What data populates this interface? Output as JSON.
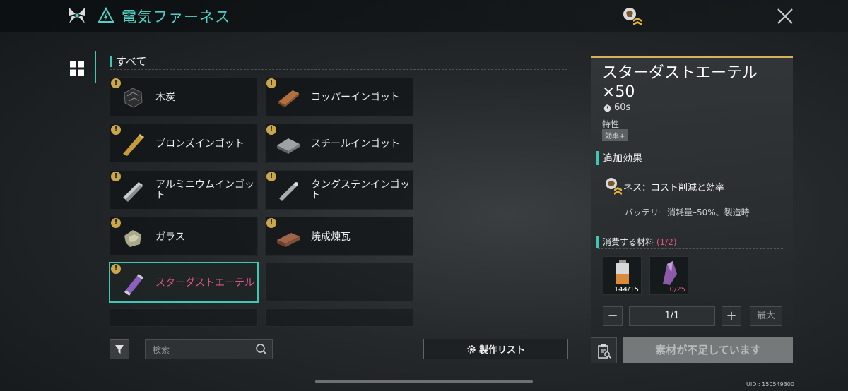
{
  "header": {
    "title": "電気ファーネス",
    "icons": [
      "game-logo-icon",
      "electric-furnace-icon",
      "rank-badge-icon",
      "close-icon"
    ]
  },
  "category": {
    "label": "すべて"
  },
  "items": [
    {
      "name": "木炭",
      "icon": "charcoal-icon"
    },
    {
      "name": "コッパーインゴット",
      "icon": "copper-ingot-icon"
    },
    {
      "name": "ブロンズインゴット",
      "icon": "bronze-ingot-icon"
    },
    {
      "name": "スチールインゴット",
      "icon": "steel-ingot-icon"
    },
    {
      "name": "アルミニウムインゴット",
      "icon": "aluminum-ingot-icon"
    },
    {
      "name": "タングステンインゴット",
      "icon": "tungsten-ingot-icon"
    },
    {
      "name": "ガラス",
      "icon": "glass-icon"
    },
    {
      "name": "焼成煉瓦",
      "icon": "fired-brick-icon"
    },
    {
      "name": "スターダストエーテル",
      "icon": "stardust-ether-icon",
      "selected": true
    }
  ],
  "search": {
    "placeholder": "検索"
  },
  "craft_list_label": "製作リスト",
  "detail": {
    "title": "スターダストエーテル ×50",
    "time": "60s",
    "trait_label": "特性",
    "trait_tag": "効率+",
    "bonus_header": "追加効果",
    "bonus_name": "ネス：コスト削減と効率",
    "bonus_desc": "バッテリー消耗量–50%、製造時",
    "materials_header": "消費する材料",
    "materials_count": "(1/2)",
    "materials": [
      {
        "icon": "battery-material-icon",
        "count": "144/15"
      },
      {
        "icon": "crystal-material-icon",
        "count": "0/25"
      }
    ],
    "quantity": "1/1",
    "max_label": "最大",
    "craft_button": "素材が不足しています"
  },
  "uid": "UID : 150549300",
  "colors": {
    "accent": "#3fc6b5",
    "selected_text": "#e0557a",
    "title_gold": "#d6b35a"
  }
}
